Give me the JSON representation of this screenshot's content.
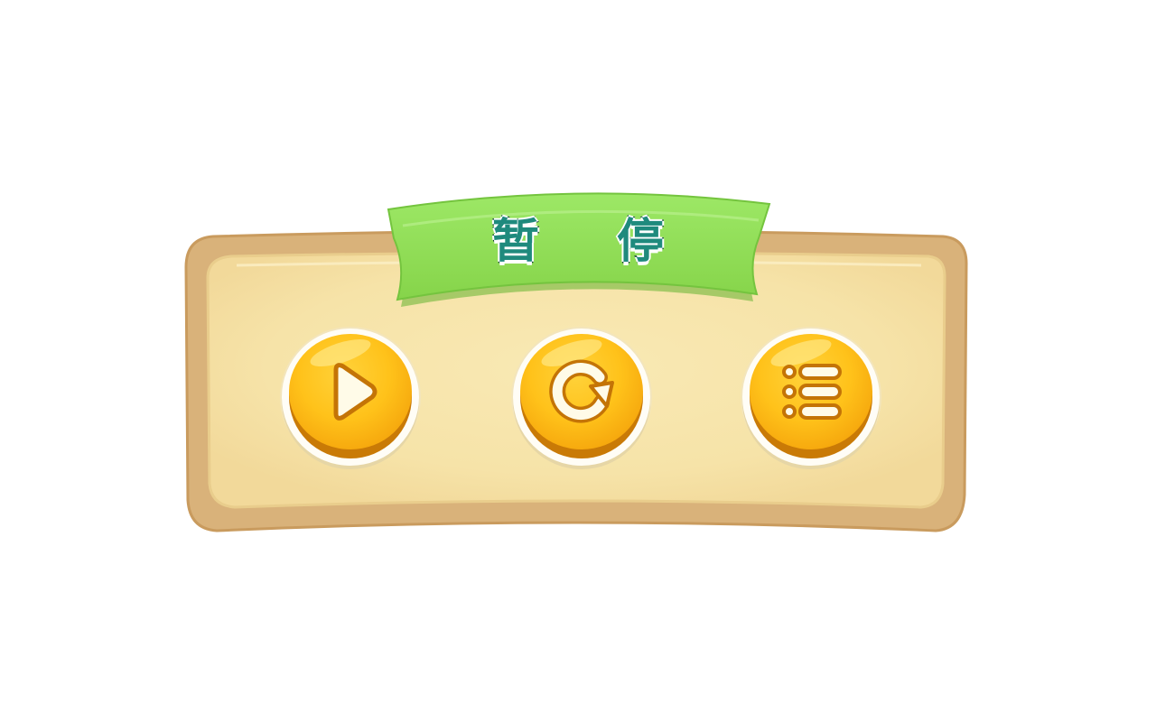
{
  "pause_dialog": {
    "title": "暂 停",
    "buttons": [
      {
        "icon": "play-icon"
      },
      {
        "icon": "restart-icon"
      },
      {
        "icon": "menu-list-icon"
      }
    ]
  },
  "colors": {
    "frame_outer": "#d9b27a",
    "frame_inner": "#f6e6b4",
    "ribbon": "#8fdc55",
    "title_text": "#1f8a7d",
    "button_gold": "#ffc21a",
    "button_rim": "#c97a06"
  }
}
